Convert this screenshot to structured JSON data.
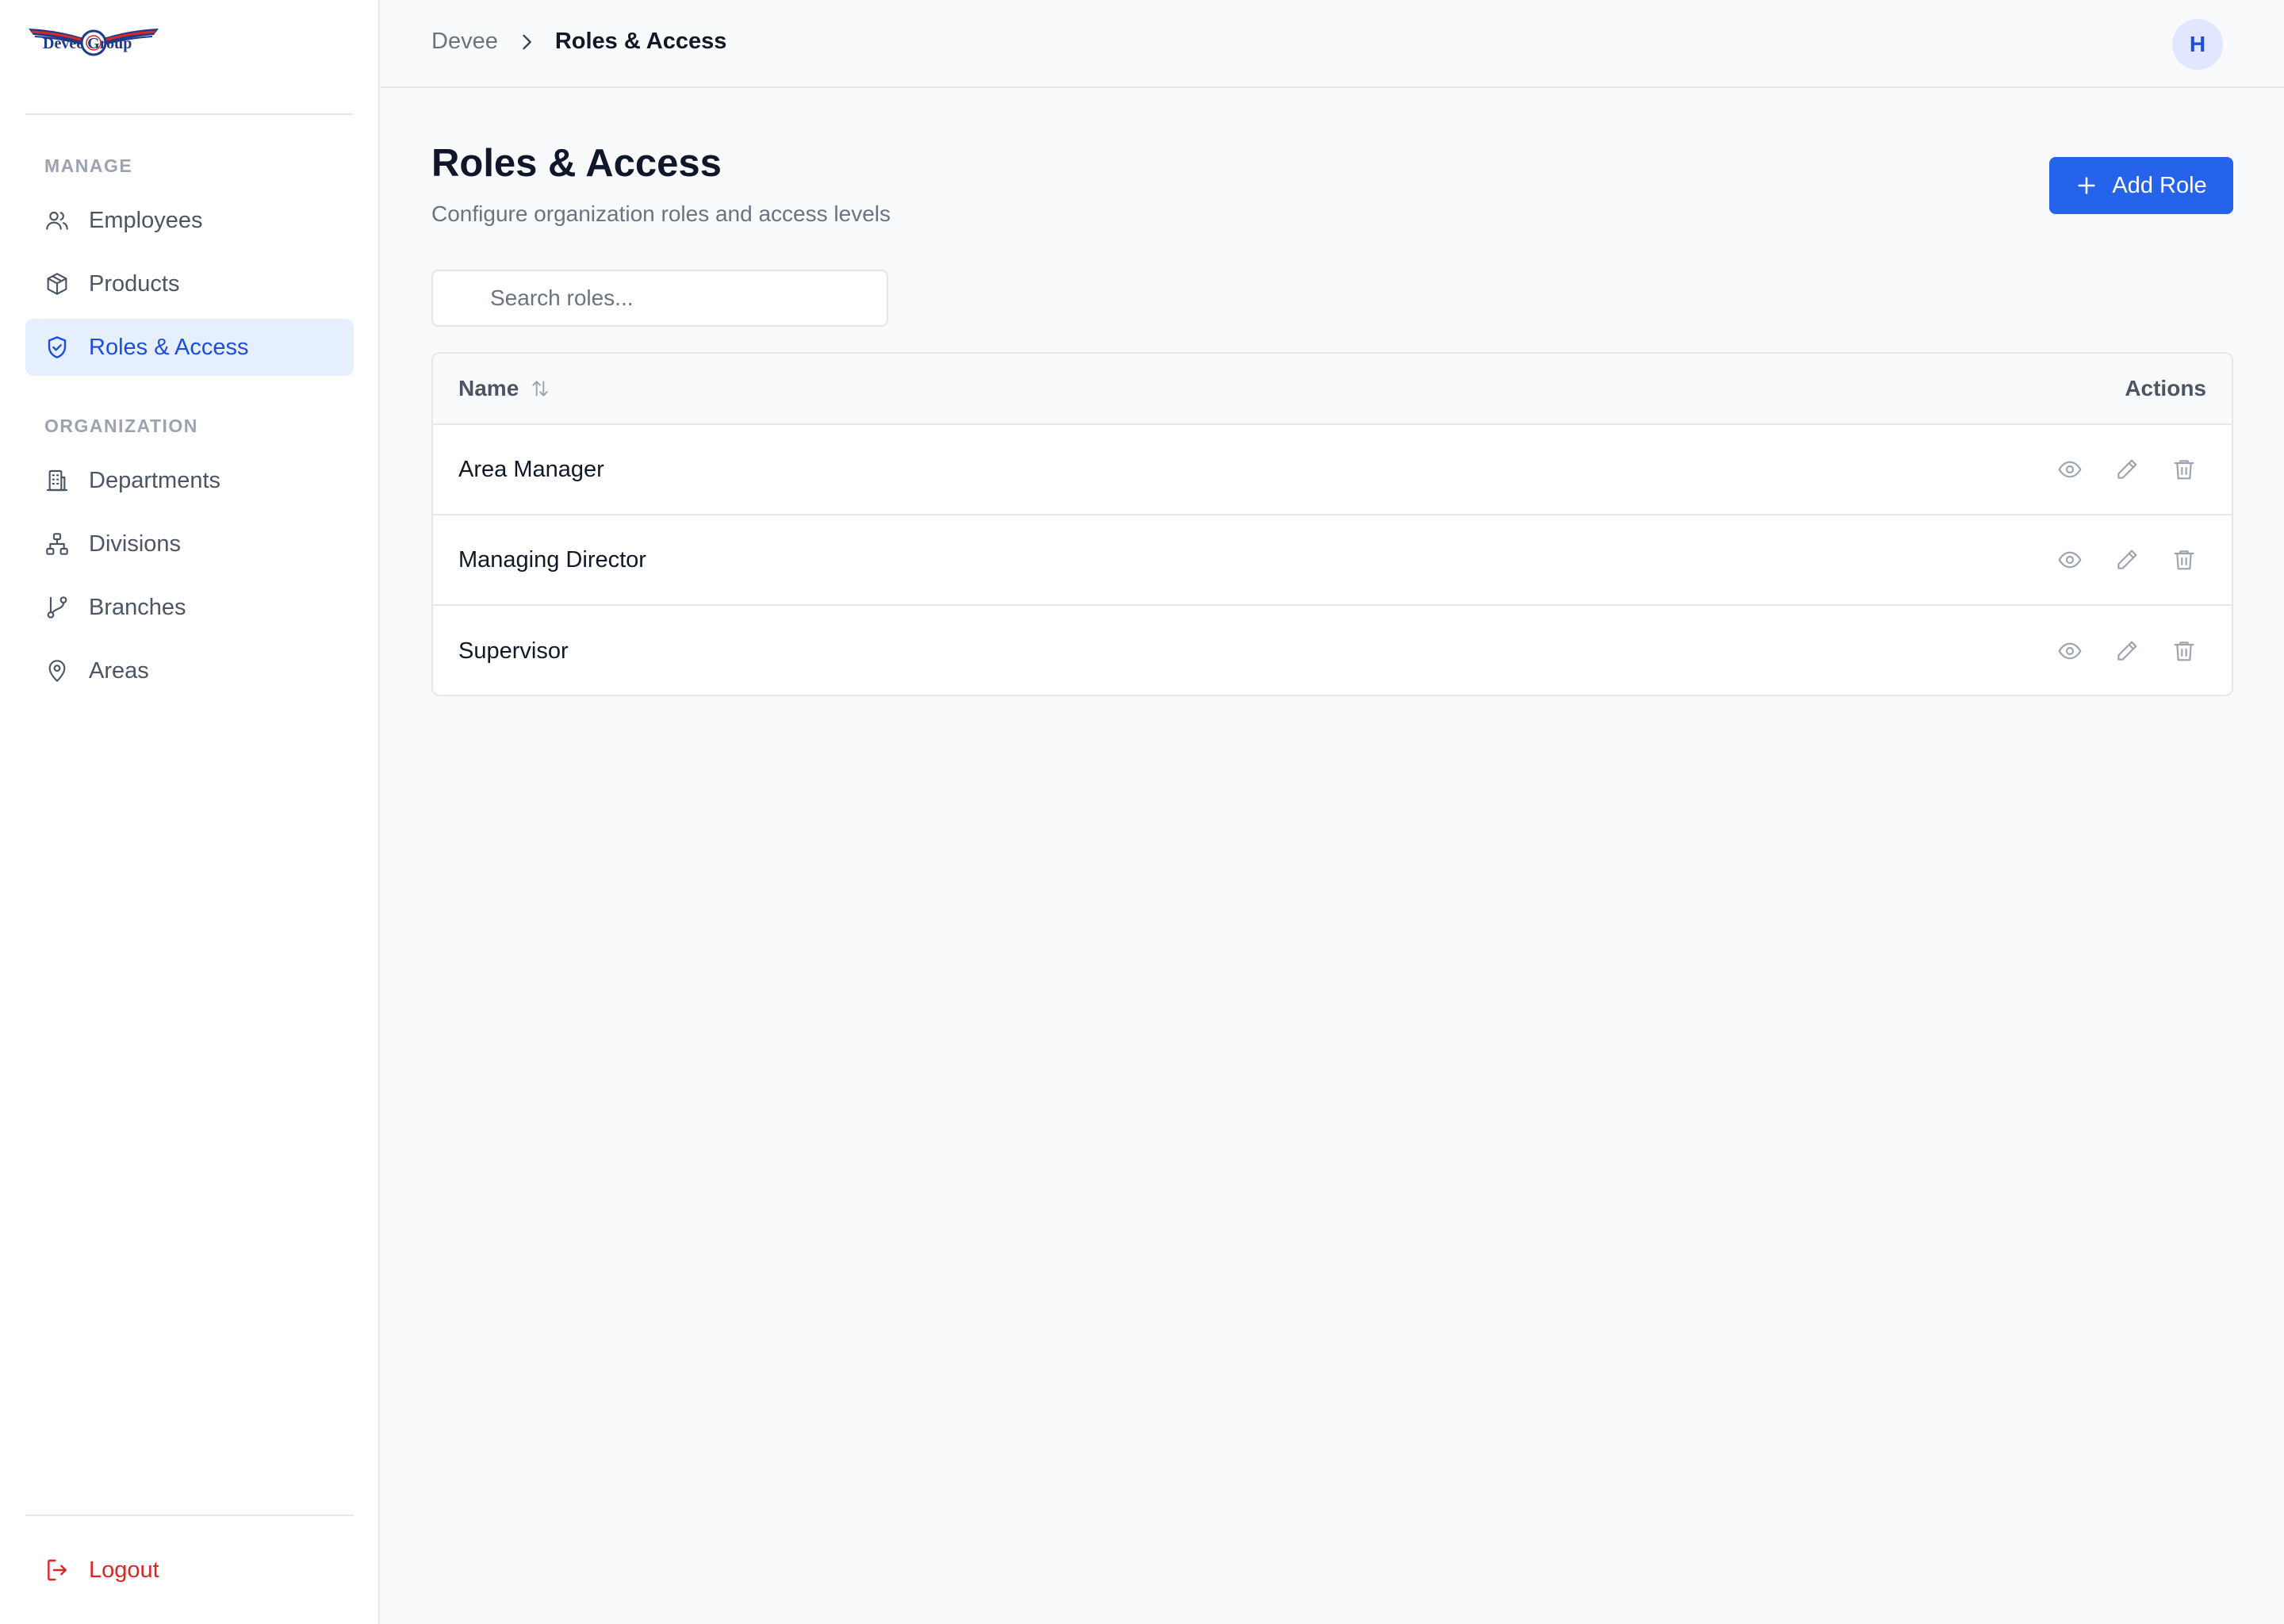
{
  "sidebar": {
    "logo_text": "Devee Group",
    "sections": [
      {
        "title": "MANAGE",
        "items": [
          {
            "label": "Employees",
            "icon": "users-icon"
          },
          {
            "label": "Products",
            "icon": "package-icon"
          },
          {
            "label": "Roles & Access",
            "icon": "shield-check-icon",
            "active": true
          }
        ]
      },
      {
        "title": "ORGANIZATION",
        "items": [
          {
            "label": "Departments",
            "icon": "building-icon"
          },
          {
            "label": "Divisions",
            "icon": "network-icon"
          },
          {
            "label": "Branches",
            "icon": "git-branch-icon"
          },
          {
            "label": "Areas",
            "icon": "map-pin-icon"
          }
        ]
      }
    ],
    "logout_label": "Logout"
  },
  "header": {
    "breadcrumb": [
      "Devee",
      "Roles & Access"
    ],
    "avatar_initial": "H"
  },
  "main": {
    "title": "Roles & Access",
    "subtitle": "Configure organization roles and access levels",
    "add_button_label": "Add Role",
    "search": {
      "placeholder": "Search roles...",
      "value": ""
    },
    "table": {
      "columns": [
        "Name",
        "Actions"
      ],
      "rows": [
        {
          "name": "Area Manager"
        },
        {
          "name": "Managing Director"
        },
        {
          "name": "Supervisor"
        }
      ]
    }
  },
  "colors": {
    "accent": "#2563eb",
    "active_bg": "#e6effd",
    "danger": "#dc2626"
  }
}
